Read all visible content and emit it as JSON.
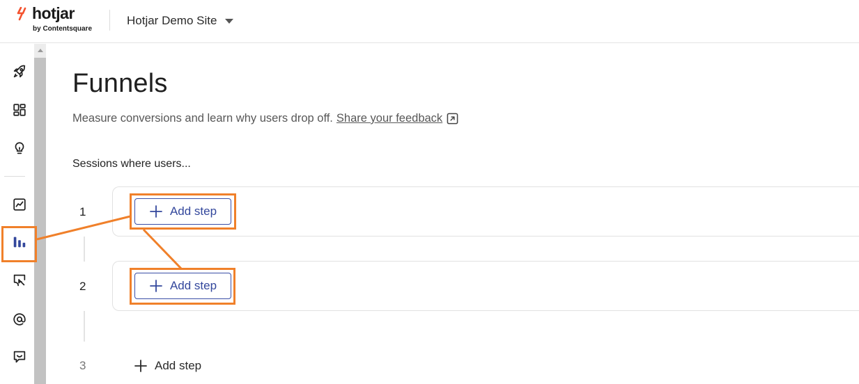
{
  "header": {
    "logo_text": "hotjar",
    "logo_sub": "by Contentsquare",
    "site_name": "Hotjar Demo Site"
  },
  "sidebar": {
    "items": [
      {
        "icon": "rocket-icon"
      },
      {
        "icon": "dashboard-icon"
      },
      {
        "icon": "lightbulb-icon"
      },
      {
        "icon": "trend-icon"
      },
      {
        "icon": "funnels-icon",
        "active": true
      },
      {
        "icon": "heatmap-icon"
      },
      {
        "icon": "at-icon"
      },
      {
        "icon": "feedback-icon"
      }
    ]
  },
  "main": {
    "title": "Funnels",
    "subtitle": "Measure conversions and learn why users drop off.",
    "feedback_link": "Share your feedback",
    "sessions_label": "Sessions where users...",
    "steps": [
      {
        "number": "1",
        "button": "Add step"
      },
      {
        "number": "2",
        "button": "Add step"
      },
      {
        "number": "3",
        "button": "Add step"
      }
    ]
  },
  "colors": {
    "accent": "#33479c",
    "highlight": "#f0802a",
    "logo": "#f4522e"
  }
}
